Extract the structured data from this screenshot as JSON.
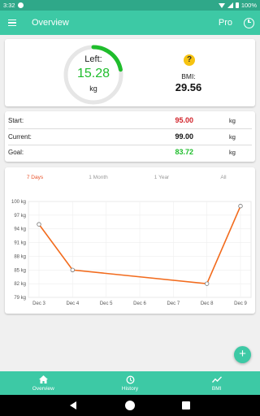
{
  "status_bar": {
    "time": "3:32",
    "battery": "100%"
  },
  "app_bar": {
    "title": "Overview",
    "pro_label": "Pro"
  },
  "gauge": {
    "label": "Left:",
    "value": "15.28",
    "unit": "kg",
    "progress_fraction": 0.22,
    "color": "#1fbd2c"
  },
  "bmi": {
    "help": "?",
    "label": "BMI:",
    "value": "29.56"
  },
  "stats": [
    {
      "label": "Start:",
      "value": "95.00",
      "unit": "kg",
      "color": "#d2232a"
    },
    {
      "label": "Current:",
      "value": "99.00",
      "unit": "kg",
      "color": "#111111"
    },
    {
      "label": "Goal:",
      "value": "83.72",
      "unit": "kg",
      "color": "#1fbd2c"
    }
  ],
  "chart_tabs": [
    "7 Days",
    "1 Month",
    "1 Year",
    "All"
  ],
  "active_tab": 0,
  "chart_data": {
    "type": "line",
    "x": [
      "Dec 3",
      "Dec 4",
      "Dec 5",
      "Dec 6",
      "Dec 7",
      "Dec 8",
      "Dec 9"
    ],
    "y_tick_labels": [
      "100 kg",
      "97 kg",
      "94 kg",
      "91 kg",
      "88 kg",
      "85 kg",
      "82 kg",
      "79 kg"
    ],
    "y_ticks": [
      100,
      97,
      94,
      91,
      88,
      85,
      82,
      79
    ],
    "ylim": [
      79,
      100
    ],
    "series": [
      {
        "points": [
          {
            "x": "Dec 3",
            "y": 95.0
          },
          {
            "x": "Dec 4",
            "y": 85.0
          },
          {
            "x": "Dec 8",
            "y": 82.0
          },
          {
            "x": "Dec 9",
            "y": 99.0
          }
        ],
        "color": "#f26b1d"
      }
    ],
    "grid": true
  },
  "fab": {
    "label": "+"
  },
  "bottom_nav": [
    {
      "label": "Overview",
      "icon": "home-icon"
    },
    {
      "label": "History",
      "icon": "history-icon"
    },
    {
      "label": "BMI",
      "icon": "trend-icon"
    }
  ]
}
